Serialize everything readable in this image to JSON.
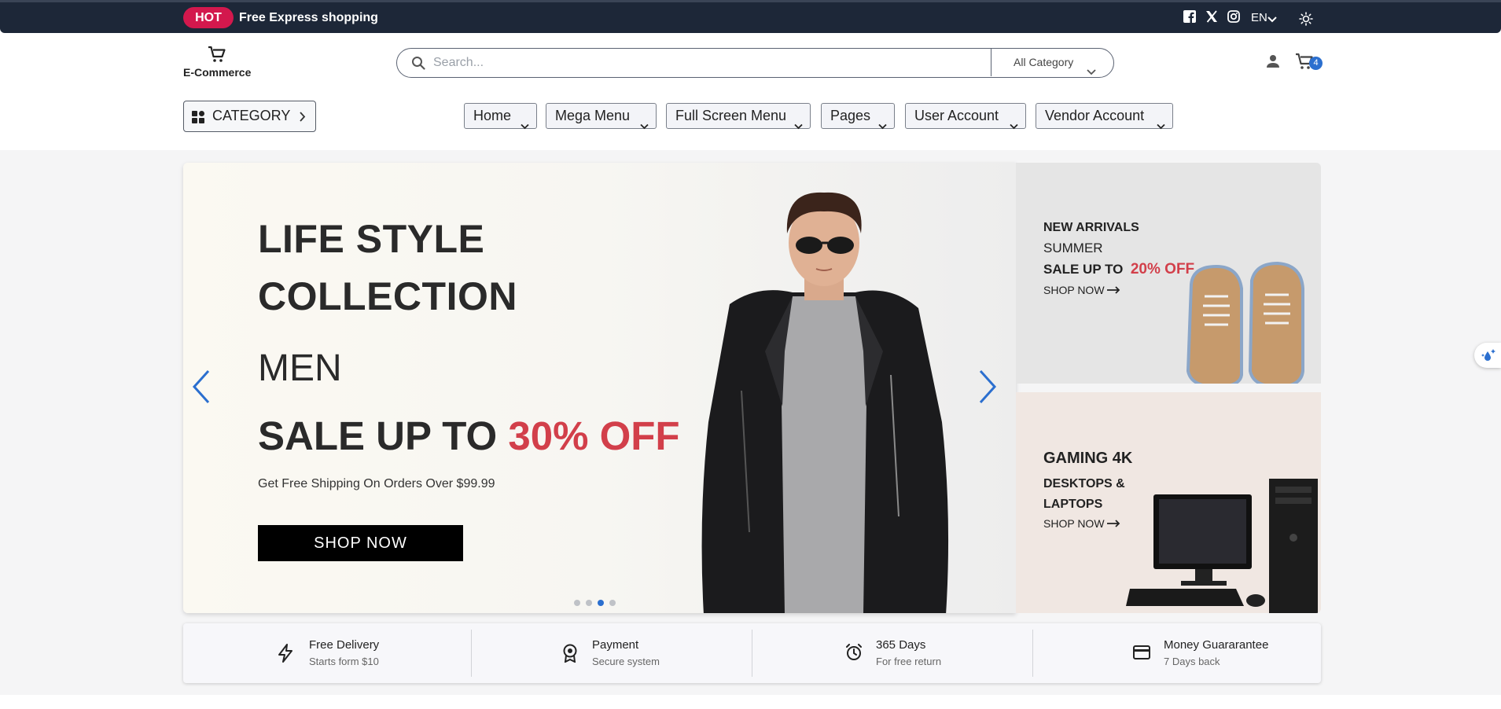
{
  "topbar": {
    "badge": "HOT",
    "promo": "Free Express shopping",
    "social_icons": [
      "facebook-icon",
      "x-twitter-icon",
      "instagram-icon"
    ],
    "language": "EN",
    "theme_icon": "sun-icon"
  },
  "header": {
    "logo_text": "E-Commerce",
    "search_placeholder": "Search...",
    "search_category": "All Category",
    "cart_count": "4"
  },
  "nav": {
    "category_label": "CATEGORY",
    "items": [
      {
        "label": "Home"
      },
      {
        "label": "Mega Menu"
      },
      {
        "label": "Full Screen Menu"
      },
      {
        "label": "Pages"
      },
      {
        "label": "User Account"
      },
      {
        "label": "Vendor Account"
      }
    ]
  },
  "hero": {
    "line1": "LIFE STYLE",
    "line2": "COLLECTION",
    "line3": "MEN",
    "sale_prefix": "SALE UP TO",
    "sale_highlight": "30% OFF",
    "subtitle": "Get Free Shipping On Orders Over $99.99",
    "cta": "SHOP NOW",
    "slide_count": 4,
    "active_slide": 3
  },
  "side_banners": {
    "top": {
      "title": "NEW ARRIVALS",
      "subtitle": "SUMMER",
      "sale_prefix": "SALE UP TO",
      "sale_highlight": "20% OFF",
      "link": "SHOP NOW"
    },
    "bottom": {
      "title": "GAMING 4K",
      "line1": "DESKTOPS &",
      "line2": "LAPTOPS",
      "link": "SHOP NOW"
    }
  },
  "features": [
    {
      "icon": "lightning-icon",
      "title": "Free Delivery",
      "subtitle": "Starts form $10"
    },
    {
      "icon": "award-icon",
      "title": "Payment",
      "subtitle": "Secure system"
    },
    {
      "icon": "alarm-clock-icon",
      "title": "365 Days",
      "subtitle": "For free return"
    },
    {
      "icon": "credit-card-icon",
      "title": "Money Guararantee",
      "subtitle": "7 Days back"
    }
  ],
  "colors": {
    "topbar_bg": "#1d2738",
    "hot_badge": "#d3184d",
    "sale_red": "#d23f4a",
    "accent_blue": "#2b6fcf"
  }
}
